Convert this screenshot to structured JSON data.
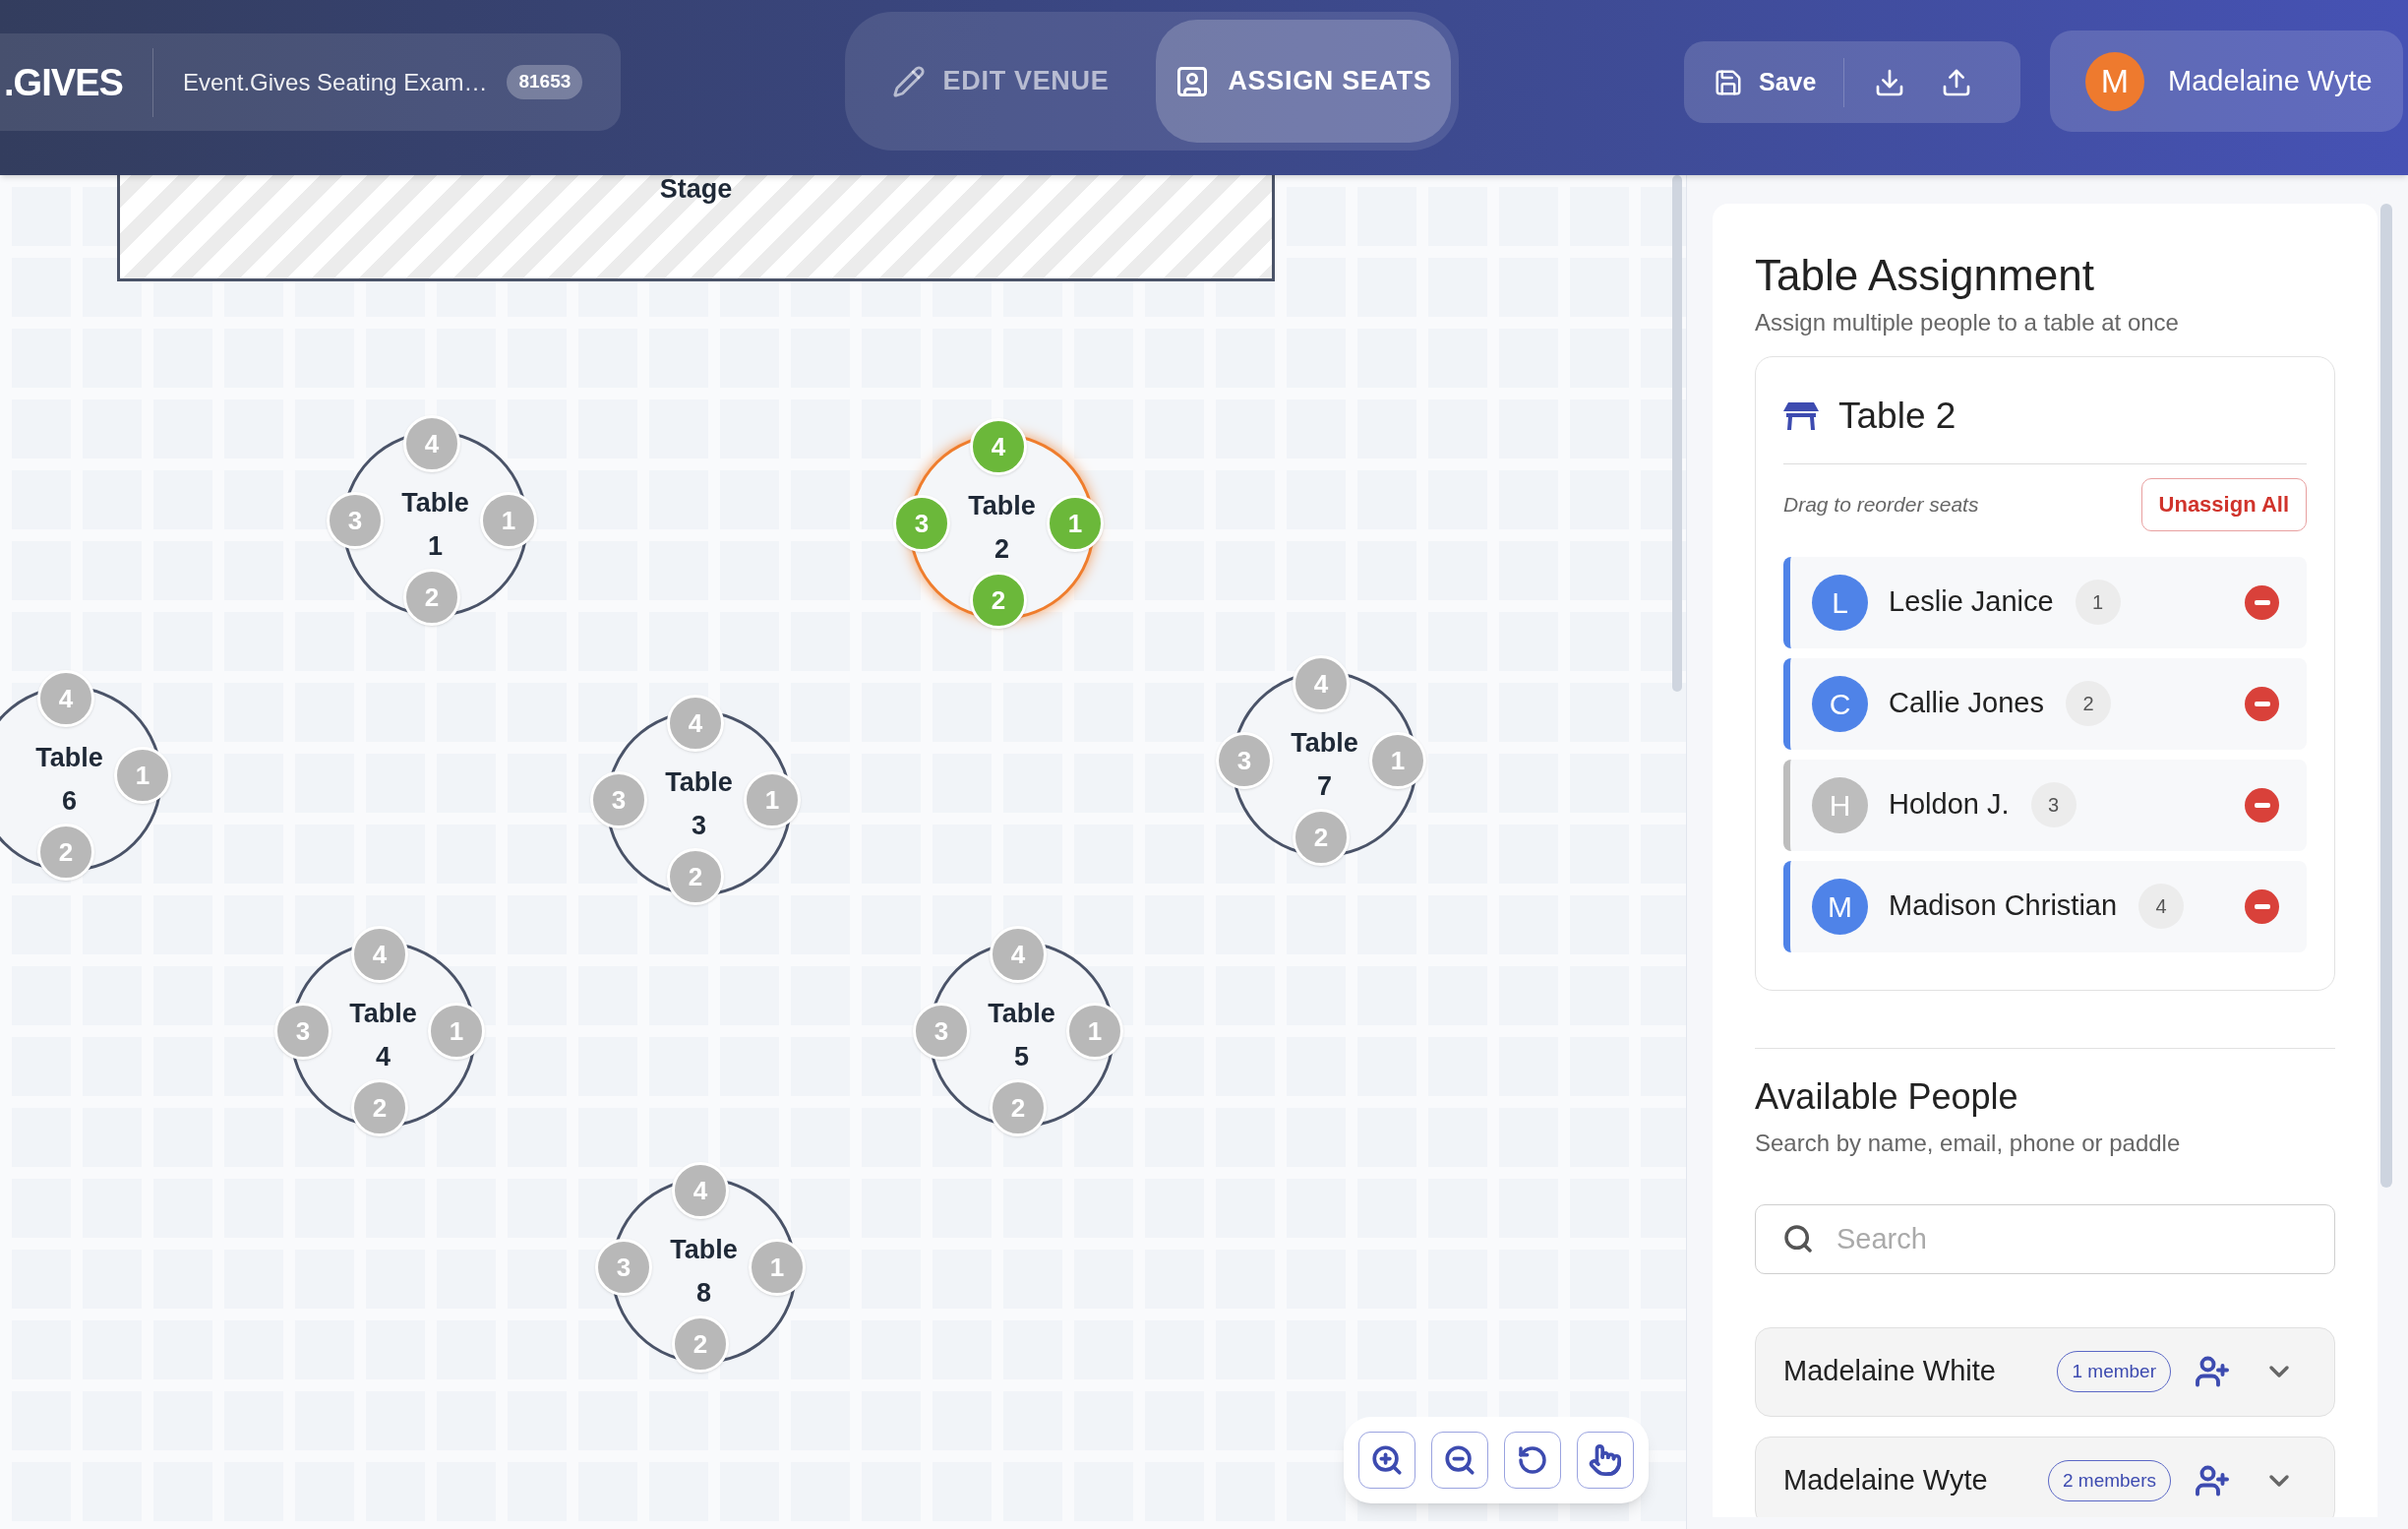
{
  "header": {
    "logo": ".GIVES",
    "event_name": "Event.Gives Seating Exam…",
    "event_id": "81653",
    "modes": [
      {
        "label": "EDIT VENUE",
        "kind": "edit",
        "selected": false
      },
      {
        "label": "ASSIGN SEATS",
        "kind": "assign",
        "selected": true
      }
    ],
    "save_label": "Save",
    "user": {
      "initial": "M",
      "name": "Madelaine Wyte"
    }
  },
  "canvas": {
    "stage_label": "Stage",
    "tables": [
      {
        "label": "Table",
        "number": "1",
        "selected": false,
        "seats": [
          {
            "label": "1",
            "assigned": false
          },
          {
            "label": "2",
            "assigned": false
          },
          {
            "label": "3",
            "assigned": false
          },
          {
            "label": "4",
            "assigned": false
          }
        ]
      },
      {
        "label": "Table",
        "number": "2",
        "selected": true,
        "seats": [
          {
            "label": "1",
            "assigned": true
          },
          {
            "label": "2",
            "assigned": true
          },
          {
            "label": "3",
            "assigned": true
          },
          {
            "label": "4",
            "assigned": true
          }
        ]
      },
      {
        "label": "Table",
        "number": "6",
        "selected": false,
        "seats": [
          {
            "label": "1",
            "assigned": false
          },
          {
            "label": "2",
            "assigned": false
          },
          {
            "label": "4",
            "assigned": false
          }
        ]
      },
      {
        "label": "Table",
        "number": "3",
        "selected": false,
        "seats": [
          {
            "label": "1",
            "assigned": false
          },
          {
            "label": "2",
            "assigned": false
          },
          {
            "label": "3",
            "assigned": false
          },
          {
            "label": "4",
            "assigned": false
          }
        ]
      },
      {
        "label": "Table",
        "number": "7",
        "selected": false,
        "seats": [
          {
            "label": "1",
            "assigned": false
          },
          {
            "label": "2",
            "assigned": false
          },
          {
            "label": "3",
            "assigned": false
          },
          {
            "label": "4",
            "assigned": false
          }
        ]
      },
      {
        "label": "Table",
        "number": "4",
        "selected": false,
        "seats": [
          {
            "label": "1",
            "assigned": false
          },
          {
            "label": "2",
            "assigned": false
          },
          {
            "label": "3",
            "assigned": false
          },
          {
            "label": "4",
            "assigned": false
          }
        ]
      },
      {
        "label": "Table",
        "number": "5",
        "selected": false,
        "seats": [
          {
            "label": "1",
            "assigned": false
          },
          {
            "label": "2",
            "assigned": false
          },
          {
            "label": "3",
            "assigned": false
          },
          {
            "label": "4",
            "assigned": false
          }
        ]
      },
      {
        "label": "Table",
        "number": "8",
        "selected": false,
        "seats": [
          {
            "label": "1",
            "assigned": false
          },
          {
            "label": "2",
            "assigned": false
          },
          {
            "label": "3",
            "assigned": false
          },
          {
            "label": "4",
            "assigned": false
          }
        ]
      }
    ]
  },
  "panel": {
    "title": "Table Assignment",
    "subtitle": "Assign multiple people to a table at once",
    "table": {
      "name": "Table 2",
      "hint": "Drag to reorder seats",
      "unassign_label": "Unassign All",
      "seats": [
        {
          "initial": "L",
          "name": "Leslie Janice",
          "seat": "1",
          "color": "#4f83e8"
        },
        {
          "initial": "C",
          "name": "Callie Jones",
          "seat": "2",
          "color": "#4f83e8"
        },
        {
          "initial": "H",
          "name": "Holdon J.",
          "seat": "3",
          "color": "#bdbdbd"
        },
        {
          "initial": "M",
          "name": "Madison Christian",
          "seat": "4",
          "color": "#4f83e8"
        }
      ]
    },
    "available": {
      "title": "Available People",
      "subtitle": "Search by name, email, phone or paddle",
      "search_placeholder": "Search",
      "people": [
        {
          "name": "Madelaine White",
          "members": "1 member"
        },
        {
          "name": "Madelaine Wyte",
          "members": "2 members"
        }
      ]
    }
  }
}
